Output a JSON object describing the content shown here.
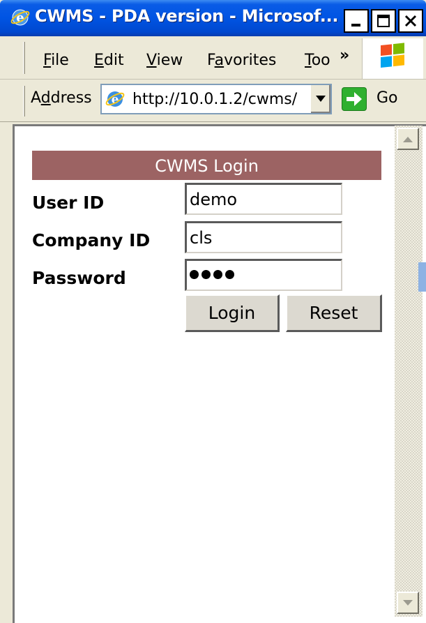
{
  "window": {
    "title": "CWMS - PDA version - Microsof...",
    "minimize_icon": "minimize-icon",
    "maximize_icon": "maximize-icon",
    "close_icon": "close-icon"
  },
  "menu": {
    "items": [
      {
        "label": "File",
        "accel": "F"
      },
      {
        "label": "Edit",
        "accel": "E"
      },
      {
        "label": "View",
        "accel": "V"
      },
      {
        "label": "Favorites",
        "accel": "a"
      },
      {
        "label": "Too",
        "accel": "T"
      }
    ],
    "overflow": "»"
  },
  "address": {
    "label": "Address",
    "url": "http://10.0.1.2/cwms/",
    "go_label": "Go"
  },
  "login": {
    "header": "CWMS Login",
    "user_label": "User ID",
    "user_value": "demo",
    "company_label": "Company ID",
    "company_value": "cls",
    "password_label": "Password",
    "password_length": 4,
    "login_button": "Login",
    "reset_button": "Reset"
  },
  "colors": {
    "titlebar": "#0054e3",
    "login_header_bg": "#9c6363",
    "go_green": "#2fb02f"
  }
}
